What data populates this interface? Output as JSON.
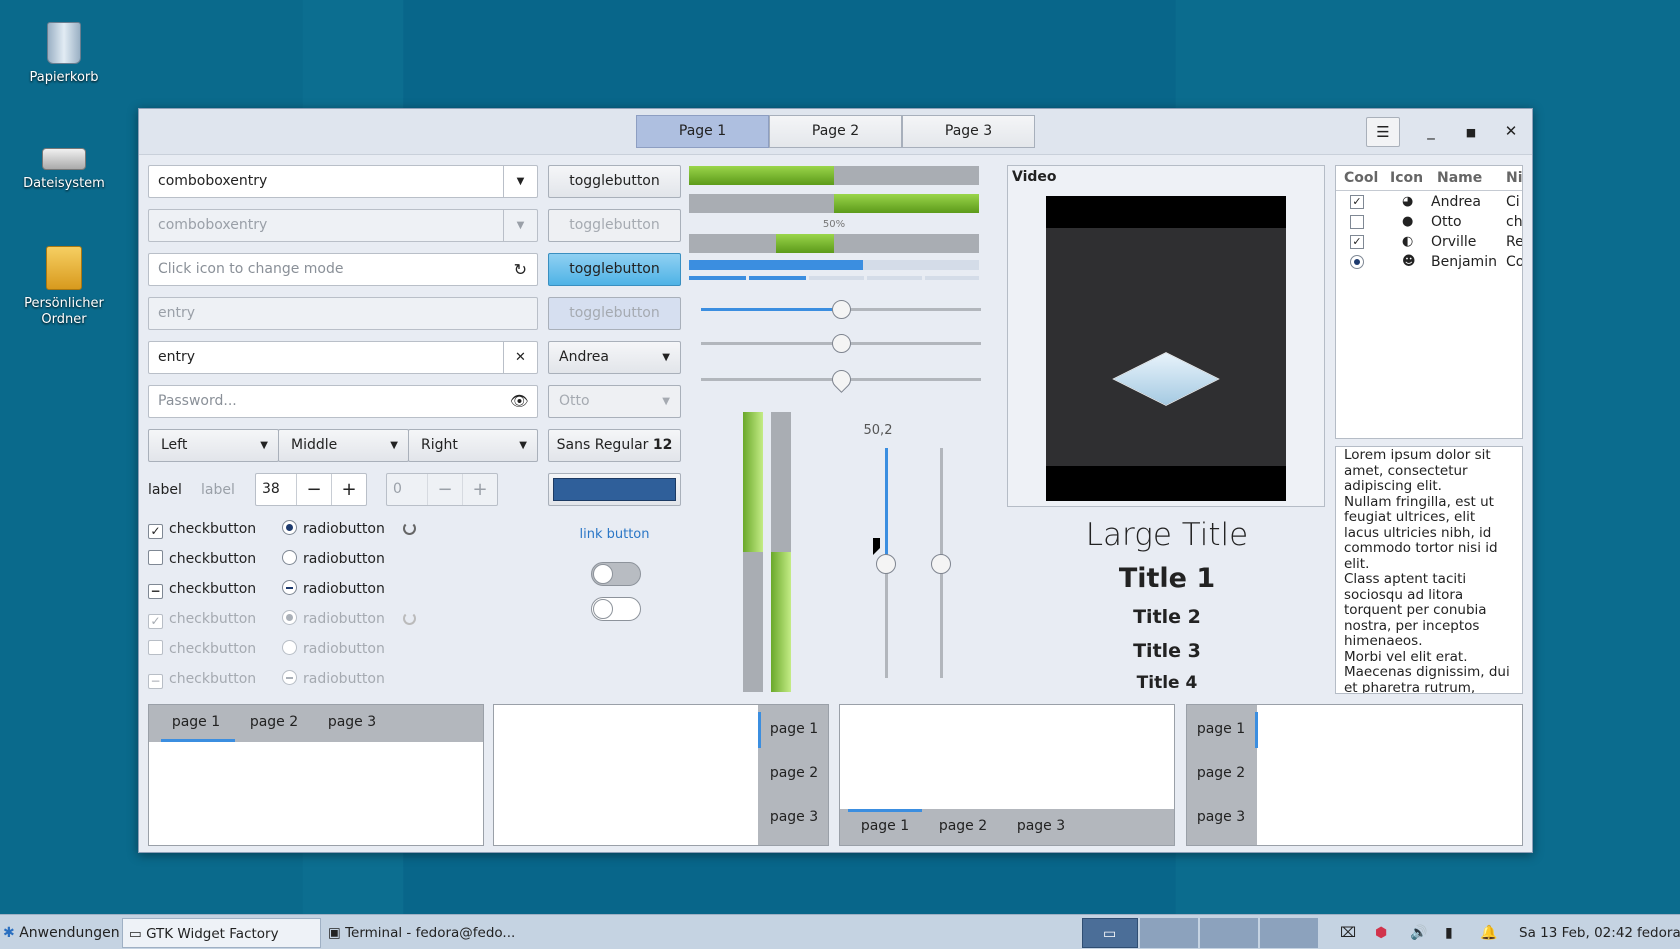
{
  "desktop": {
    "icons": [
      {
        "label": "Papierkorb"
      },
      {
        "label": "Dateisystem"
      },
      {
        "label": "Persönlicher Ordner"
      }
    ]
  },
  "window": {
    "tabs": [
      "Page 1",
      "Page 2",
      "Page 3"
    ],
    "menu_icon": "hamburger-icon",
    "controls": [
      "minimize-icon",
      "maximize-icon",
      "close-icon"
    ],
    "entries": {
      "combo1": "comboboxentry",
      "combo2": "comboboxentry",
      "icon_mode": "Click icon to change mode",
      "entry_dis": "entry",
      "entry": "entry",
      "password": "Password..."
    },
    "dropdowns": {
      "left": "Left",
      "middle": "Middle",
      "right": "Right"
    },
    "labels": {
      "l1": "label",
      "l2": "label"
    },
    "spin1": "38",
    "spin2": "0",
    "toggles": [
      "togglebutton",
      "togglebutton",
      "togglebutton",
      "togglebutton"
    ],
    "combo_andrea": "Andrea",
    "combo_otto": "Otto",
    "font_button": {
      "name": "Sans Regular",
      "size": "12"
    },
    "color_button": "#2f5f9a",
    "link_button": "link button",
    "checks": [
      "checkbutton",
      "checkbutton",
      "checkbutton",
      "checkbutton",
      "checkbutton",
      "checkbutton"
    ],
    "radios": [
      "radiobutton",
      "radiobutton",
      "radiobutton",
      "radiobutton",
      "radiobutton",
      "radiobutton"
    ],
    "progress_label": "50%",
    "scale_value": "50,2",
    "video": {
      "title": "Video"
    },
    "titles": {
      "large": "Large Title",
      "t1": "Title 1",
      "t2": "Title 2",
      "t3": "Title 3",
      "t4": "Title 4"
    },
    "tree": {
      "headers": [
        "Cool",
        "Icon",
        "Name",
        "Ni"
      ],
      "rows": [
        {
          "cool": "checked",
          "name": "Andrea",
          "ni": "Ci"
        },
        {
          "cool": "unchecked",
          "name": "Otto",
          "ni": "ch"
        },
        {
          "cool": "checked",
          "name": "Orville",
          "ni": "Re"
        },
        {
          "cool": "radio",
          "name": "Benjamin",
          "ni": "Co"
        }
      ]
    },
    "text_view": "Lorem ipsum dolor sit amet, consectetur adipiscing elit.\nNullam fringilla, est ut feugiat ultrices, elit lacus ultricies nibh, id commodo tortor nisi id elit.\nClass aptent taciti sociosqu ad litora torquent per conubia nostra, per inceptos himenaeos.\nMorbi vel elit erat. Maecenas dignissim, dui et pharetra rutrum,",
    "notebook_tabs": [
      "page 1",
      "page 2",
      "page 3"
    ]
  },
  "taskbar": {
    "apps": "Anwendungen",
    "task1": "GTK Widget Factory",
    "task2": "Terminal - fedora@fedo...",
    "clock": "Sa 13 Feb, 02:42",
    "user": "fedora"
  }
}
